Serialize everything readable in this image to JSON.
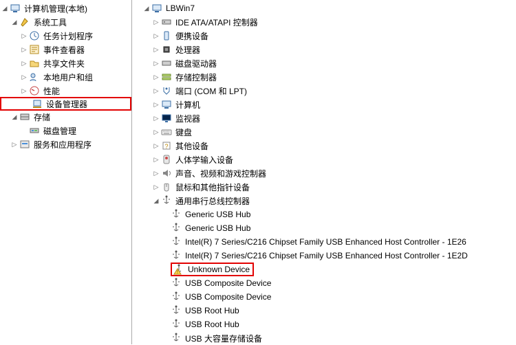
{
  "left_tree": {
    "root_label": "计算机管理(本地)",
    "system_tools_label": "系统工具",
    "task_scheduler_label": "任务计划程序",
    "event_viewer_label": "事件查看器",
    "shared_folders_label": "共享文件夹",
    "local_users_label": "本地用户和组",
    "performance_label": "性能",
    "device_manager_label": "设备管理器",
    "storage_label": "存储",
    "disk_management_label": "磁盘管理",
    "services_apps_label": "服务和应用程序"
  },
  "right_tree": {
    "computer_label": "LBWin7",
    "categories": {
      "ide_ata": "IDE ATA/ATAPI 控制器",
      "portable_devices": "便携设备",
      "processors": "处理器",
      "disk_drives": "磁盘驱动器",
      "storage_controllers": "存储控制器",
      "ports": "端口 (COM 和 LPT)",
      "computer": "计算机",
      "monitors": "监视器",
      "keyboards": "键盘",
      "other_devices": "其他设备",
      "hid": "人体学输入设备",
      "sound": "声音、视频和游戏控制器",
      "mice": "鼠标和其他指针设备",
      "usb_controllers": "通用串行总线控制器"
    },
    "usb_children": [
      "Generic USB Hub",
      "Generic USB Hub",
      "Intel(R) 7 Series/C216 Chipset Family USB Enhanced Host Controller - 1E26",
      "Intel(R) 7 Series/C216 Chipset Family USB Enhanced Host Controller - 1E2D",
      "Unknown Device",
      "USB Composite Device",
      "USB Composite Device",
      "USB Root Hub",
      "USB Root Hub",
      "USB 大容量存储设备"
    ]
  }
}
